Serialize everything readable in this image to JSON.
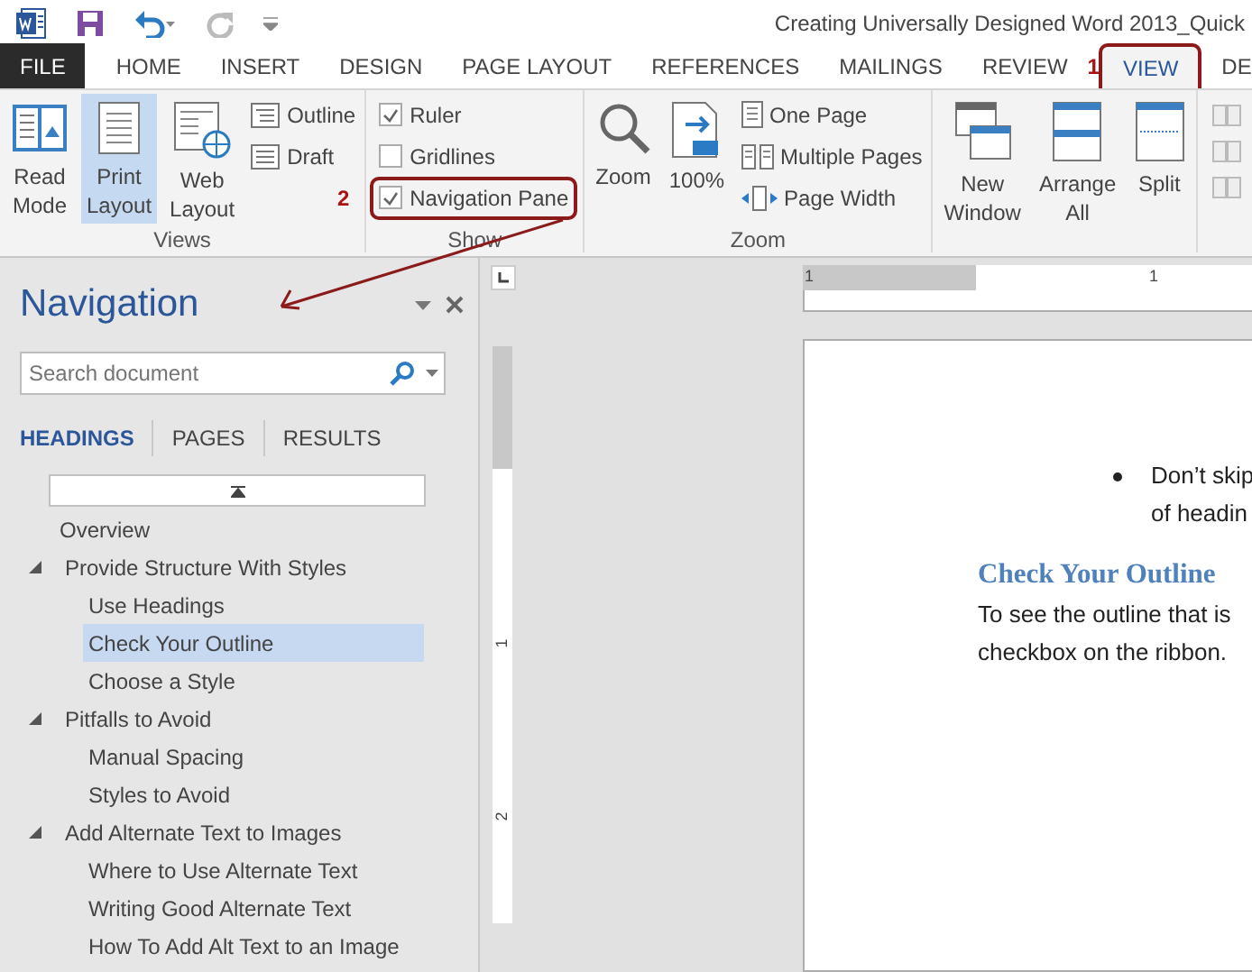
{
  "window": {
    "title": "Creating Universally Designed Word 2013_Quick"
  },
  "ribbon_tabs": [
    {
      "label": "FILE",
      "kind": "file",
      "selected": false
    },
    {
      "label": "HOME",
      "selected": false
    },
    {
      "label": "INSERT",
      "selected": false
    },
    {
      "label": "DESIGN",
      "selected": false
    },
    {
      "label": "PAGE LAYOUT",
      "selected": false
    },
    {
      "label": "REFERENCES",
      "selected": false
    },
    {
      "label": "MAILINGS",
      "selected": false
    },
    {
      "label": "REVIEW",
      "selected": false
    },
    {
      "label": "VIEW",
      "selected": true,
      "callout": "1"
    },
    {
      "label": "DE",
      "selected": false
    }
  ],
  "ribbon_groups": [
    {
      "label": "Views",
      "items": [
        {
          "kind": "large",
          "lines": [
            "Read",
            "Mode"
          ],
          "selected": false
        },
        {
          "kind": "large",
          "lines": [
            "Print",
            "Layout"
          ],
          "selected": true
        },
        {
          "kind": "large",
          "lines": [
            "Web",
            "Layout"
          ],
          "selected": false
        },
        {
          "kind": "stack",
          "entries": [
            {
              "label": "Outline"
            },
            {
              "label": "Draft"
            }
          ]
        }
      ]
    },
    {
      "label": "Show",
      "items": [
        {
          "kind": "checks",
          "entries": [
            {
              "label": "Ruler",
              "checked": true
            },
            {
              "label": "Gridlines",
              "checked": false
            },
            {
              "label": "Navigation Pane",
              "checked": true,
              "callout": "2"
            }
          ]
        }
      ]
    },
    {
      "label": "Zoom",
      "items": [
        {
          "kind": "large",
          "lines": [
            "Zoom"
          ],
          "selected": false
        },
        {
          "kind": "large",
          "lines": [
            "100%"
          ],
          "selected": false
        },
        {
          "kind": "stack",
          "entries": [
            {
              "label": "One Page"
            },
            {
              "label": "Multiple Pages"
            },
            {
              "label": "Page Width"
            }
          ]
        }
      ]
    },
    {
      "items": [
        {
          "kind": "large",
          "lines": [
            "New",
            "Window"
          ],
          "selected": false
        },
        {
          "kind": "large",
          "lines": [
            "Arrange",
            "All"
          ],
          "selected": false
        },
        {
          "kind": "large",
          "lines": [
            "Split"
          ],
          "selected": false
        }
      ]
    }
  ],
  "navigation": {
    "title": "Navigation",
    "search": {
      "placeholder": "Search document"
    },
    "tabs": [
      {
        "label": "HEADINGS",
        "selected": true
      },
      {
        "label": "PAGES",
        "selected": false
      },
      {
        "label": "RESULTS",
        "selected": false
      }
    ],
    "headings": [
      {
        "label": "Overview",
        "selected": false
      },
      {
        "label": "Provide Structure With Styles",
        "selected": false,
        "expanded": true,
        "children": [
          {
            "label": "Use Headings",
            "selected": false
          },
          {
            "label": "Check Your Outline",
            "selected": true
          },
          {
            "label": "Choose a Style",
            "selected": false
          }
        ]
      },
      {
        "label": "Pitfalls to Avoid",
        "selected": false,
        "expanded": true,
        "children": [
          {
            "label": "Manual Spacing",
            "selected": false
          },
          {
            "label": "Styles to Avoid",
            "selected": false
          }
        ]
      },
      {
        "label": "Add Alternate Text to Images",
        "selected": false,
        "expanded": true,
        "children": [
          {
            "label": "Where to Use Alternate Text",
            "selected": false
          },
          {
            "label": "Writing Good Alternate Text",
            "selected": false
          },
          {
            "label": "How To Add Alt Text to an Image",
            "selected": false
          }
        ]
      }
    ]
  },
  "ruler": {
    "horizontal_labels": [
      "1",
      "1"
    ],
    "vertical_labels": [
      "1",
      "2"
    ]
  },
  "document": {
    "bullet_lines": [
      "Don’t skip",
      "of headin"
    ],
    "heading": "Check Your Outline",
    "paragraph_lines": [
      "To see the outline that is",
      "checkbox on the ribbon."
    ]
  }
}
